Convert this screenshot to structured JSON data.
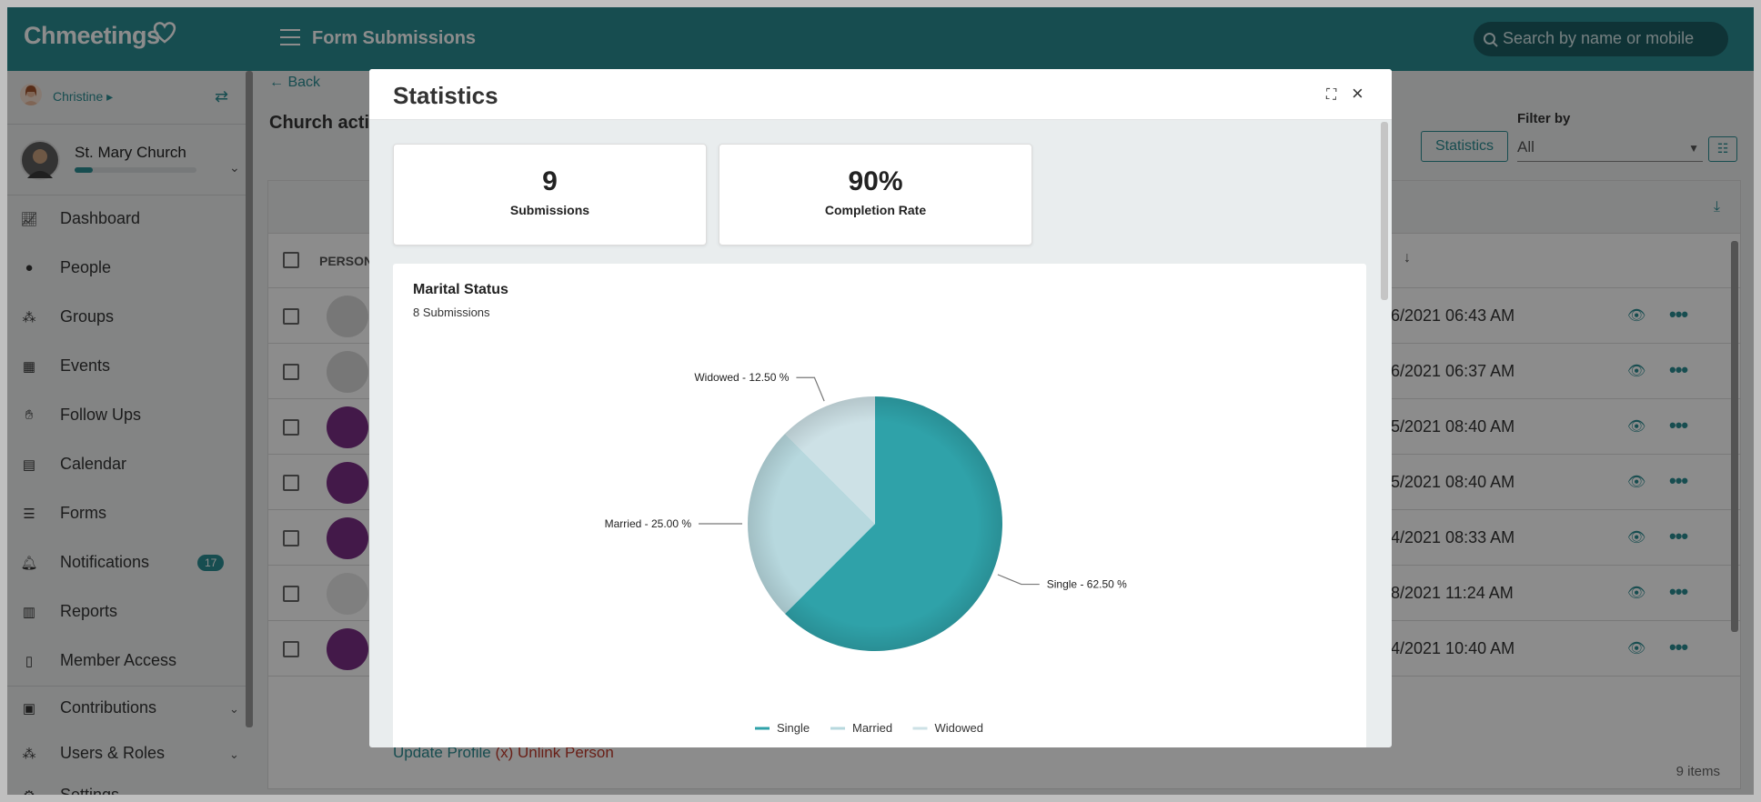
{
  "app": {
    "logo": "Chmeetings",
    "page_title": "Form Submissions",
    "search_placeholder": "Search by name or mobile"
  },
  "sidebar": {
    "user_name": "Christine",
    "church_name": "St. Mary Church",
    "church_progress": 0.15,
    "items": [
      {
        "label": "Dashboard",
        "icon": "chart-icon"
      },
      {
        "label": "People",
        "icon": "person-icon"
      },
      {
        "label": "Groups",
        "icon": "groups-icon"
      },
      {
        "label": "Events",
        "icon": "calendar-icon"
      },
      {
        "label": "Follow Ups",
        "icon": "handshake-icon"
      },
      {
        "label": "Calendar",
        "icon": "calendar-grid-icon"
      },
      {
        "label": "Forms",
        "icon": "list-icon"
      },
      {
        "label": "Notifications",
        "icon": "bell-icon",
        "badge": "17"
      },
      {
        "label": "Reports",
        "icon": "bar-chart-icon"
      },
      {
        "label": "Member Access",
        "icon": "mobile-icon"
      },
      {
        "label": "Contributions",
        "icon": "money-icon"
      },
      {
        "label": "Users & Roles",
        "icon": "users-icon"
      },
      {
        "label": "Settings",
        "icon": "gear-icon"
      }
    ]
  },
  "main": {
    "back": "Back",
    "heading": "Church acti",
    "statistics_button": "Statistics",
    "filter_label": "Filter by",
    "filter_value": "All",
    "column_person": "PERSON",
    "rows": [
      {
        "date": "6/2021 06:43 AM"
      },
      {
        "date": "6/2021 06:37 AM"
      },
      {
        "date": "5/2021 08:40 AM"
      },
      {
        "date": "5/2021 08:40 AM"
      },
      {
        "date": "4/2021 08:33 AM"
      },
      {
        "date": "8/2021 11:24 AM"
      },
      {
        "date": "4/2021 10:40 AM"
      }
    ],
    "update_profile": "Update Profile",
    "unlink_person": "(x) Unlink Person",
    "footer": "9 items"
  },
  "modal": {
    "title": "Statistics",
    "cards": [
      {
        "value": "9",
        "label": "Submissions"
      },
      {
        "value": "90%",
        "label": "Completion Rate"
      }
    ],
    "chart_title": "Marital Status",
    "chart_subtitle": "8 Submissions"
  },
  "colors": {
    "brand": "#2b8c92",
    "single": "#2fa2a9",
    "married": "#b7d8de",
    "widowed": "#cde1e6"
  },
  "chart_data": {
    "type": "pie",
    "title": "Marital Status",
    "subtitle": "8 Submissions",
    "categories": [
      "Single",
      "Married",
      "Widowed"
    ],
    "values": [
      62.5,
      25.0,
      12.5
    ],
    "labels": [
      "Single - 62.50 %",
      "Married - 25.00 %",
      "Widowed - 12.50 %"
    ],
    "legend": "bottom"
  }
}
